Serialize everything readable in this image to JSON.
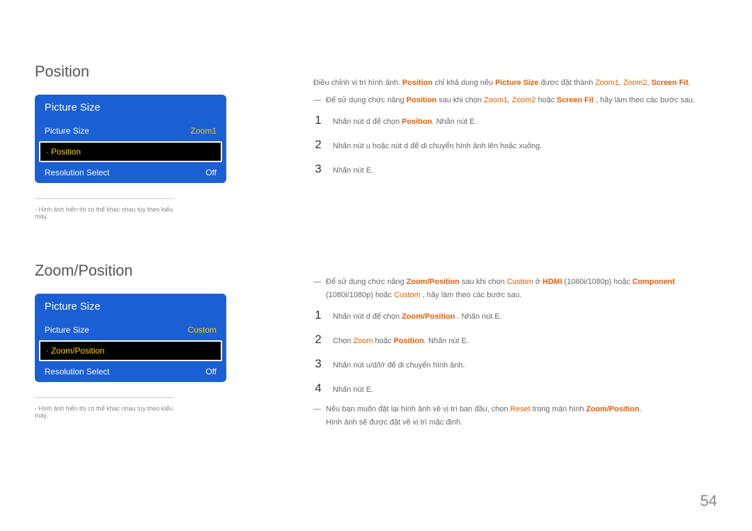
{
  "page_number": "54",
  "section1": {
    "title": "Position",
    "menu": {
      "header": "Picture Size",
      "rows": [
        {
          "label": "Picture Size",
          "value": "Zoom1",
          "selected": false
        },
        {
          "label": "· Position",
          "value": "",
          "selected": true
        },
        {
          "label": "Resolution Select",
          "value": "Off",
          "selected": false
        }
      ]
    },
    "caption": "- Hình ảnh hiển thị có thể khác nhau tùy theo kiểu máy.",
    "intro": {
      "pre": "Điều chỉnh vị trí hình ảnh. ",
      "kw1": "Position",
      "mid1": " chỉ khả dụng nếu ",
      "kw2": "Picture Size",
      "mid2": " được đặt thành ",
      "kw3": "Zoom1",
      "c1": ", ",
      "kw4": "Zoom2",
      "c2": ", ",
      "kw5": "Screen Fit",
      "end": "."
    },
    "note": {
      "pre": "Để sử dụng chức năng ",
      "kw1": "Position",
      "mid1": " sau khi chọn ",
      "kw2": "Zoom1",
      "c1": ", ",
      "kw3": "Zoom2",
      "mid2": " hoặc ",
      "kw4": "Screen Fit",
      "end": " , hãy làm theo các bước sau."
    },
    "steps": [
      {
        "num": "1",
        "pre": "Nhấn nút d để chọn ",
        "kw": "Position",
        "post": ". Nhấn nút E."
      },
      {
        "num": "2",
        "text": "Nhấn nút u hoặc nút d để di chuyển hình ảnh lên hoặc xuống."
      },
      {
        "num": "3",
        "text": "Nhấn nút E."
      }
    ]
  },
  "section2": {
    "title": "Zoom/Position",
    "menu": {
      "header": "Picture Size",
      "rows": [
        {
          "label": "Picture Size",
          "value": "Custom",
          "selected": false
        },
        {
          "label": "· Zoom/Position",
          "value": "",
          "selected": true
        },
        {
          "label": "Resolution Select",
          "value": "Off",
          "selected": false
        }
      ]
    },
    "caption": "- Hình ảnh hiển thị có thể khác nhau tùy theo kiểu máy.",
    "note1": {
      "pre": "Để sử dụng chức năng ",
      "kw1": "Zoom/Position",
      "mid1": " sau khi chọn ",
      "kw2": "Custom",
      "mid2": " ở ",
      "kw3": "HDMI",
      "mid3": " (1080i/1080p) hoặc ",
      "kw4": "Component",
      "line2a": "(1080i/1080p) hoặc ",
      "kw5": "Custom",
      "line2b": " , hãy làm theo các bước sau."
    },
    "steps": [
      {
        "num": "1",
        "pre": "Nhấn nút d để chọn ",
        "kw": "Zoom/Position",
        "post": " . Nhấn nút E."
      },
      {
        "num": "2",
        "pre": "Chọn ",
        "kw1": "Zoom",
        "mid": " hoặc ",
        "kw2": "Position",
        "post": ". Nhấn nút E."
      },
      {
        "num": "3",
        "text": "Nhấn nút u/d/l/r để di chuyển hình ảnh."
      },
      {
        "num": "4",
        "text": "Nhấn nút E."
      }
    ],
    "note2": {
      "line1a": "Nếu bạn muốn đặt lại hình ảnh về vị trí ban đầu, chọn ",
      "kw1": "Reset",
      "line1b": " trong màn hình ",
      "kw2": "Zoom/Position",
      "line1c": ".",
      "line2": "Hình ảnh sẽ được đặt về vị trí mặc định."
    }
  }
}
